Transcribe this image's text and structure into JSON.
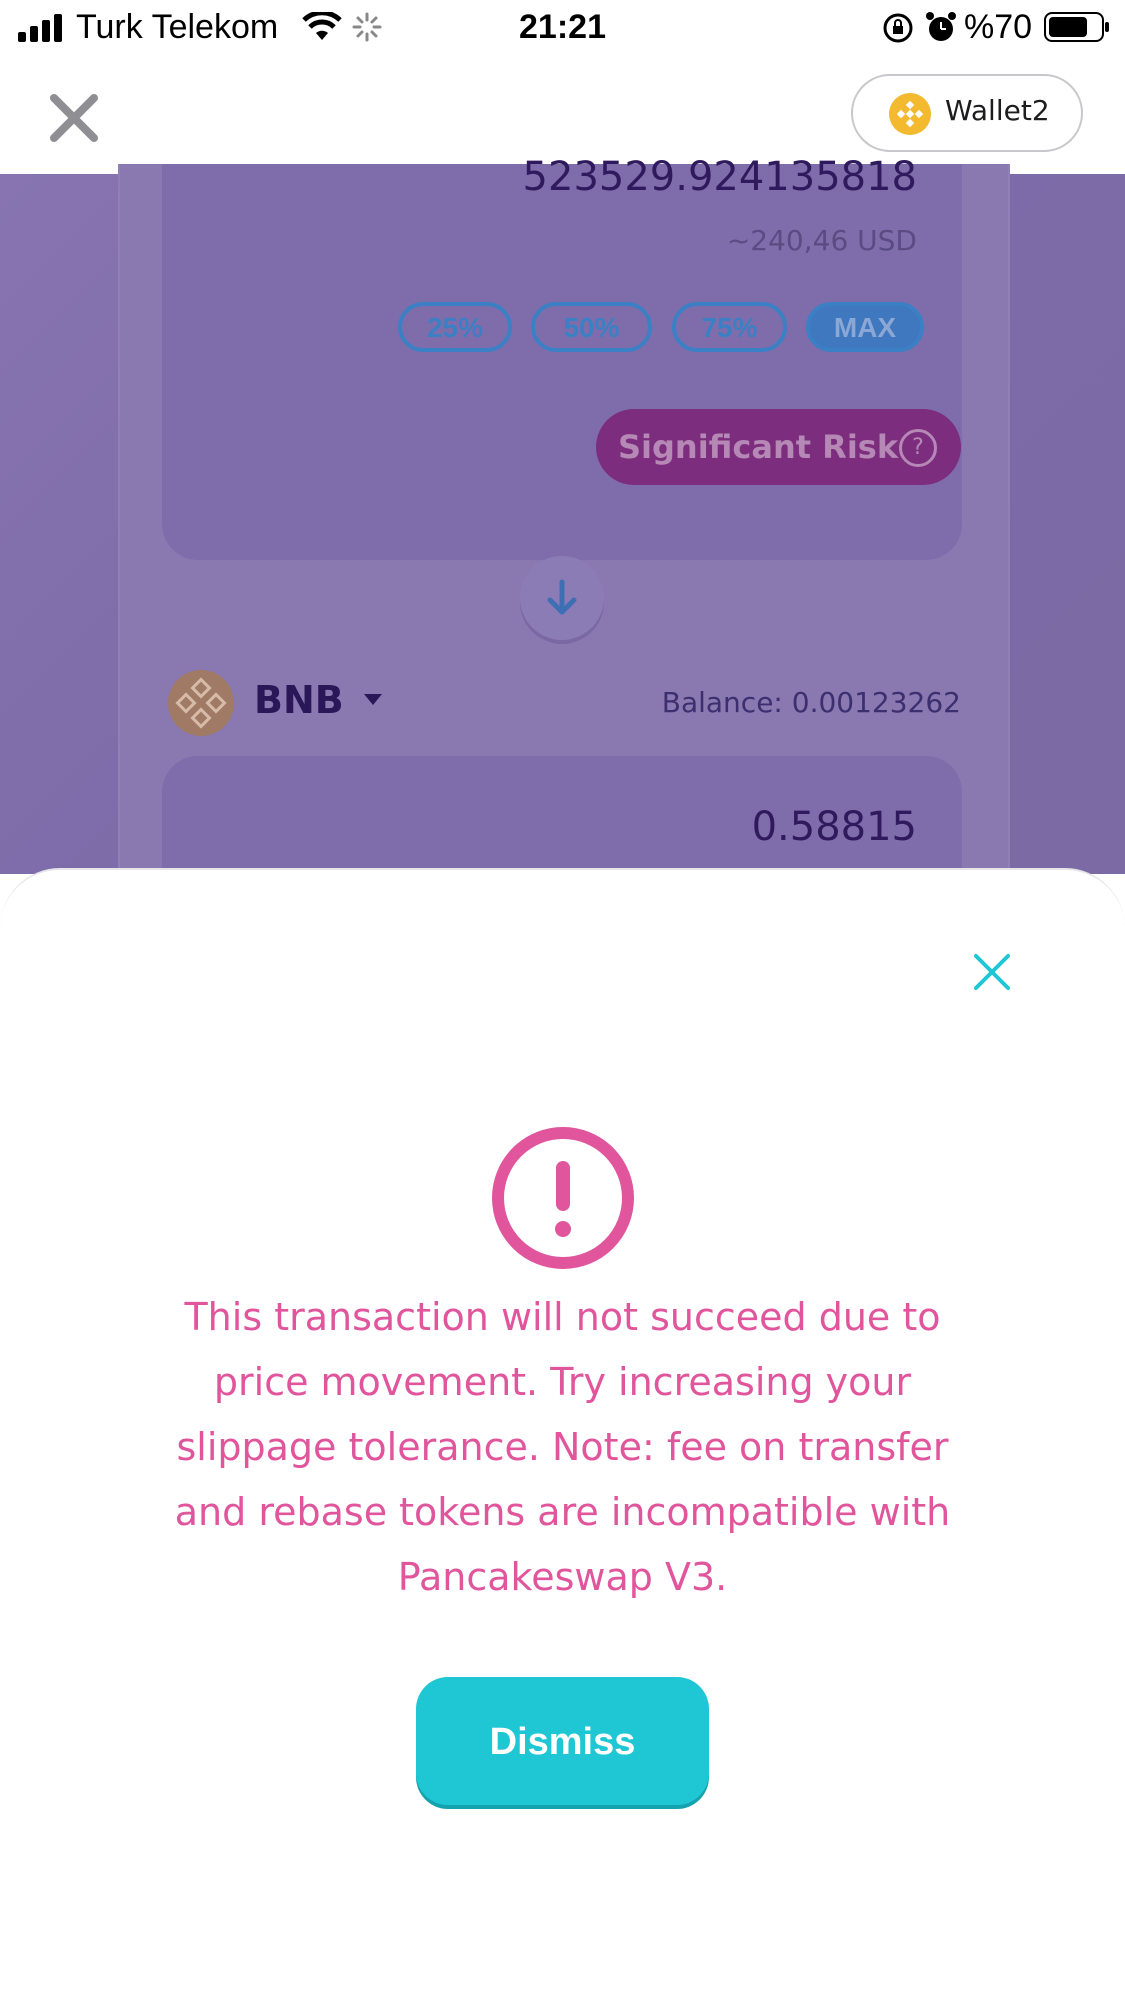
{
  "status_bar": {
    "carrier": "Turk Telekom",
    "time": "21:21",
    "battery": "%70"
  },
  "header": {
    "wallet_label": "Wallet2"
  },
  "swap": {
    "from_amount": "523529.924135818",
    "from_usd": "~240,46 USD",
    "percent_buttons": [
      "25%",
      "50%",
      "75%",
      "MAX"
    ],
    "risk_label": "Significant Risk",
    "to_token": "BNB",
    "to_balance": "Balance: 0.00123262",
    "to_amount": "0.58815"
  },
  "modal": {
    "message": "This transaction will not succeed due to price movement. Try increasing your slippage tolerance. Note: fee on transfer and rebase tokens are incompatible with Pancakeswap V3.",
    "dismiss_label": "Dismiss"
  },
  "colors": {
    "accent": "#1fc7d4",
    "error": "#e0559c",
    "risk": "#7d2d7d"
  }
}
